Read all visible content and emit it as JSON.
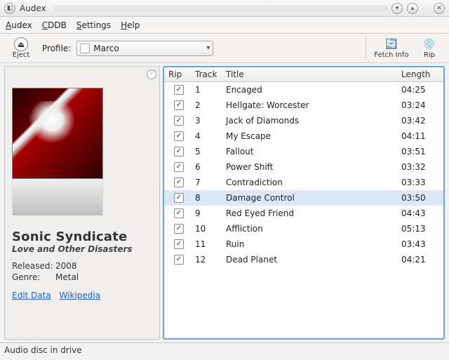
{
  "window": {
    "title": "Audex"
  },
  "menu": {
    "items": [
      "Audex",
      "CDDB",
      "Settings",
      "Help"
    ]
  },
  "toolbar": {
    "eject_label": "Eject",
    "profile_label": "Profile:",
    "profile_value": "Marco",
    "fetch_label": "Fetch Info",
    "rip_label": "Rip"
  },
  "album": {
    "artist": "Sonic Syndicate",
    "title": "Love and Other Disasters",
    "released_label": "Released:",
    "released_value": "2008",
    "genre_label": "Genre:",
    "genre_value": "Metal",
    "edit_link": "Edit Data",
    "wiki_link": "Wikipedia"
  },
  "table": {
    "headers": {
      "rip": "Rip",
      "track": "Track",
      "title": "Title",
      "length": "Length"
    },
    "selected_index": 7,
    "tracks": [
      {
        "n": "1",
        "title": "Encaged",
        "len": "04:25"
      },
      {
        "n": "2",
        "title": "Hellgate: Worcester",
        "len": "03:24"
      },
      {
        "n": "3",
        "title": "Jack of Diamonds",
        "len": "03:42"
      },
      {
        "n": "4",
        "title": "My Escape",
        "len": "04:11"
      },
      {
        "n": "5",
        "title": "Fallout",
        "len": "03:51"
      },
      {
        "n": "6",
        "title": "Power Shift",
        "len": "03:32"
      },
      {
        "n": "7",
        "title": "Contradiction",
        "len": "03:33"
      },
      {
        "n": "8",
        "title": "Damage Control",
        "len": "03:50"
      },
      {
        "n": "9",
        "title": "Red Eyed Friend",
        "len": "04:43"
      },
      {
        "n": "10",
        "title": "Affliction",
        "len": "05:13"
      },
      {
        "n": "11",
        "title": "Ruin",
        "len": "03:43"
      },
      {
        "n": "12",
        "title": "Dead Planet",
        "len": "04:21"
      }
    ]
  },
  "status": {
    "text": "Audio disc in drive"
  }
}
